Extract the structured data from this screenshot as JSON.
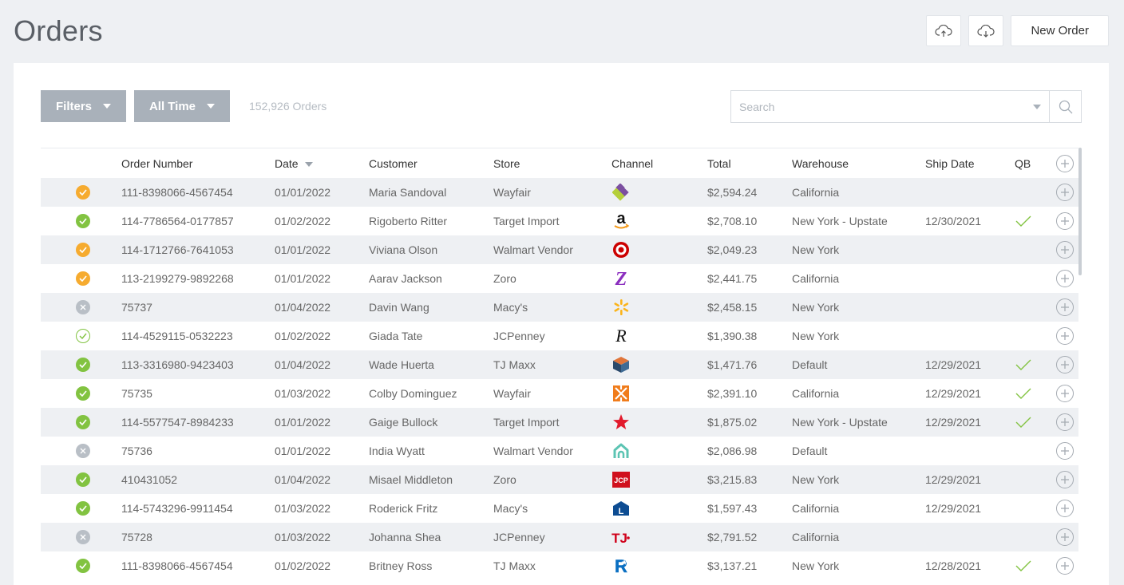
{
  "page": {
    "title": "Orders"
  },
  "actions": {
    "upload_icon": "cloud-upload-icon",
    "download_icon": "cloud-download-icon",
    "new_order_label": "New Order"
  },
  "toolbar": {
    "filters_label": "Filters",
    "time_label": "All Time",
    "order_count": "152,926 Orders",
    "search_placeholder": "Search"
  },
  "table": {
    "columns": {
      "order_number": "Order Number",
      "date": "Date",
      "customer": "Customer",
      "store": "Store",
      "channel": "Channel",
      "total": "Total",
      "warehouse": "Warehouse",
      "ship_date": "Ship Date",
      "qb": "QB"
    },
    "rows": [
      {
        "status": "pending",
        "order_number": "111-8398066-4567454",
        "date": "01/01/2022",
        "customer": "Maria Sandoval",
        "store": "Wayfair",
        "channel_icon": "wayfair-logo-icon",
        "total": "$2,594.24",
        "warehouse": "California",
        "ship_date": "",
        "qb": false
      },
      {
        "status": "complete",
        "order_number": "114-7786564-0177857",
        "date": "01/02/2022",
        "customer": "Rigoberto Ritter",
        "store": "Target Import",
        "channel_icon": "amazon-logo-icon",
        "total": "$2,708.10",
        "warehouse": "New York - Upstate",
        "ship_date": "12/30/2021",
        "qb": true
      },
      {
        "status": "pending",
        "order_number": "114-1712766-7641053",
        "date": "01/01/2022",
        "customer": "Viviana Olson",
        "store": "Walmart Vendor",
        "channel_icon": "target-logo-icon",
        "total": "$2,049.23",
        "warehouse": "New York",
        "ship_date": "",
        "qb": false
      },
      {
        "status": "pending",
        "order_number": "113-2199279-9892268",
        "date": "01/01/2022",
        "customer": "Aarav Jackson",
        "store": "Zoro",
        "channel_icon": "zoro-logo-icon",
        "total": "$2,441.75",
        "warehouse": "California",
        "ship_date": "",
        "qb": false
      },
      {
        "status": "cancelled",
        "order_number": "75737",
        "date": "01/04/2022",
        "customer": "Davin Wang",
        "store": "Macy's",
        "channel_icon": "walmart-logo-icon",
        "total": "$2,458.15",
        "warehouse": "New York",
        "ship_date": "",
        "qb": false
      },
      {
        "status": "verified",
        "order_number": "114-4529115-0532223",
        "date": "01/02/2022",
        "customer": "Giada Tate",
        "store": "JCPenney",
        "channel_icon": "script-r-logo-icon",
        "total": "$1,390.38",
        "warehouse": "New York",
        "ship_date": "",
        "qb": false
      },
      {
        "status": "complete",
        "order_number": "113-3316980-9423403",
        "date": "01/04/2022",
        "customer": "Wade Huerta",
        "store": "TJ Maxx",
        "channel_icon": "cube-logo-icon",
        "total": "$1,471.76",
        "warehouse": "Default",
        "ship_date": "12/29/2021",
        "qb": true
      },
      {
        "status": "complete",
        "order_number": "75735",
        "date": "01/03/2022",
        "customer": "Colby Dominguez",
        "store": "Wayfair",
        "channel_icon": "orange-square-logo-icon",
        "total": "$2,391.10",
        "warehouse": "California",
        "ship_date": "12/29/2021",
        "qb": true
      },
      {
        "status": "complete",
        "order_number": "114-5577547-8984233",
        "date": "01/01/2022",
        "customer": "Gaige Bullock",
        "store": "Target Import",
        "channel_icon": "macys-star-logo-icon",
        "total": "$1,875.02",
        "warehouse": "New York - Upstate",
        "ship_date": "12/29/2021",
        "qb": true
      },
      {
        "status": "cancelled",
        "order_number": "75736",
        "date": "01/01/2022",
        "customer": "India Wyatt",
        "store": "Walmart Vendor",
        "channel_icon": "house-logo-icon",
        "total": "$2,086.98",
        "warehouse": "Default",
        "ship_date": "",
        "qb": false
      },
      {
        "status": "complete",
        "order_number": "410431052",
        "date": "01/04/2022",
        "customer": "Misael Middleton",
        "store": "Zoro",
        "channel_icon": "jcp-logo-icon",
        "total": "$3,215.83",
        "warehouse": "New York",
        "ship_date": "12/29/2021",
        "qb": false
      },
      {
        "status": "complete",
        "order_number": "114-5743296-9911454",
        "date": "01/03/2022",
        "customer": "Roderick Fritz",
        "store": "Macy's",
        "channel_icon": "lowes-logo-icon",
        "total": "$1,597.43",
        "warehouse": "California",
        "ship_date": "12/29/2021",
        "qb": false
      },
      {
        "status": "cancelled",
        "order_number": "75728",
        "date": "01/03/2022",
        "customer": "Johanna Shea",
        "store": "JCPenney",
        "channel_icon": "tj-logo-icon",
        "total": "$2,791.52",
        "warehouse": "California",
        "ship_date": "",
        "qb": false
      },
      {
        "status": "complete",
        "order_number": "111-8398066-4567454",
        "date": "01/02/2022",
        "customer": "Britney Ross",
        "store": "TJ Maxx",
        "channel_icon": "toysrus-logo-icon",
        "total": "$3,137.21",
        "warehouse": "New York",
        "ship_date": "12/28/2021",
        "qb": true
      }
    ]
  },
  "colors": {
    "status_pending": "#f6ab2f",
    "status_complete": "#82c341",
    "status_cancelled": "#b9bfc6",
    "filter_button": "#a9b1ba"
  }
}
